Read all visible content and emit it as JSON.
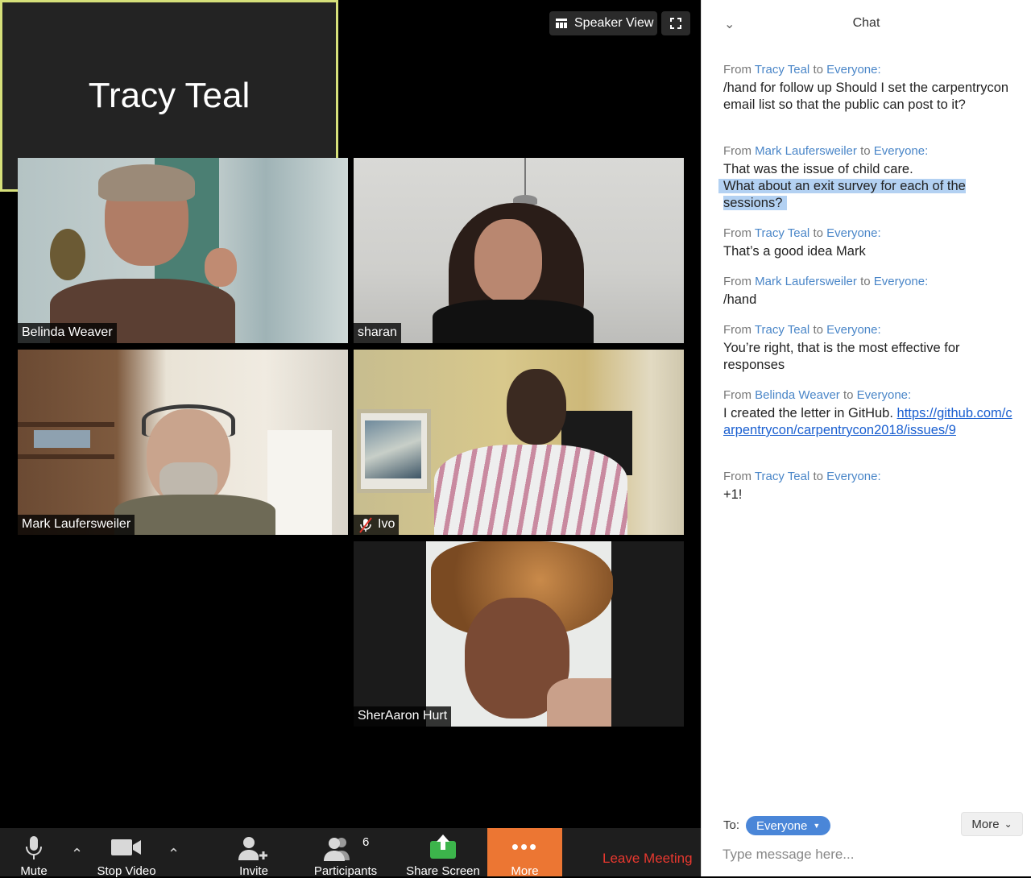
{
  "top_bar": {
    "speaker_view_label": "Speaker View"
  },
  "participants": [
    {
      "name": "Belinda Weaver"
    },
    {
      "name": "sharan"
    },
    {
      "name": "Mark Laufersweiler"
    },
    {
      "name": "Ivo",
      "muted": true
    },
    {
      "name": "Tracy Teal",
      "active_speaker": true,
      "video_off": true
    },
    {
      "name": "SherAaron Hurt"
    }
  ],
  "toolbar": {
    "mute_label": "Mute",
    "stop_video_label": "Stop Video",
    "invite_label": "Invite",
    "participants_label": "Participants",
    "participants_count": "6",
    "share_screen_label": "Share Screen",
    "more_label": "More",
    "leave_label": "Leave Meeting"
  },
  "chat": {
    "title": "Chat",
    "messages": [
      {
        "from_prefix": "From",
        "sender": "Tracy Teal",
        "to_word": "to",
        "recipient": "Everyone:",
        "text": "/hand for follow up Should I set the carpentrycon email list so that the public can post to it?"
      },
      {
        "from_prefix": "From",
        "sender": "Mark Laufersweiler",
        "to_word": "to",
        "recipient": "Everyone:",
        "text": "That was the issue of child care.",
        "text2": "What about an exit survey for each of the sessions?"
      },
      {
        "from_prefix": "From",
        "sender": "Tracy Teal",
        "to_word": "to",
        "recipient": "Everyone:",
        "text": "That’s a good idea Mark"
      },
      {
        "from_prefix": "From",
        "sender": "Mark Laufersweiler",
        "to_word": "to",
        "recipient": "Everyone:",
        "text": "/hand"
      },
      {
        "from_prefix": "From",
        "sender": "Tracy Teal",
        "to_word": "to",
        "recipient": "Everyone:",
        "text": "You’re right, that is the most effective for responses"
      },
      {
        "from_prefix": "From",
        "sender": "Belinda Weaver",
        "to_word": "to",
        "recipient": "Everyone:",
        "text": "I created the letter in GitHub.",
        "link": "https://github.com/carpentrycon/carpentrycon2018/issues/9"
      },
      {
        "from_prefix": "From",
        "sender": "Tracy Teal",
        "to_word": "to",
        "recipient": "Everyone:",
        "text": "+1!"
      }
    ],
    "to_label": "To:",
    "to_recipient": "Everyone",
    "more_label": "More",
    "input_placeholder": "Type message here..."
  },
  "colors": {
    "active_speaker_border": "#d6e07a",
    "more_button": "#ec7633",
    "leave_meeting": "#e8382f",
    "chat_name": "#4a86c8",
    "recipient_pill": "#4a86d8"
  }
}
